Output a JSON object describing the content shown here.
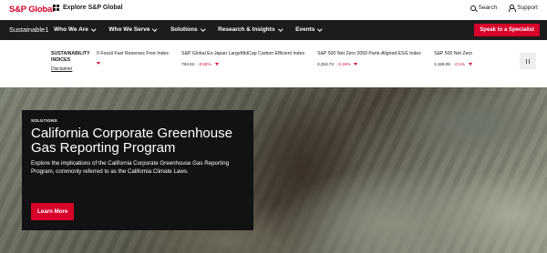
{
  "topbar": {
    "logo": "S&P Global",
    "explore_label": "Explore S&P Global",
    "search_label": "Search",
    "support_label": "Support"
  },
  "nav": {
    "brand": "Sustainable1",
    "items": [
      {
        "label": "Who We Are"
      },
      {
        "label": "Who We Serve"
      },
      {
        "label": "Solutions"
      },
      {
        "label": "Research & Insights"
      },
      {
        "label": "Events"
      }
    ],
    "cta_label": "Speak to a Specialist"
  },
  "indices": {
    "title_line1": "SUSTAINABILITY",
    "title_line2": "INDICES",
    "disclaimer": "Disclaimer",
    "cards": [
      {
        "name": "0 Fossil Fuel Reserves Free Index",
        "value": "",
        "change": ""
      },
      {
        "name": "S&P Global Ex-Japan LargeMidCap Carbon Efficient Index",
        "value": "793.04",
        "change": "-0.84%"
      },
      {
        "name": "S&P 500 Net Zero 2050 Paris-Aligned ESG Index",
        "value": "3,253.73",
        "change": "-0.15%"
      },
      {
        "name": "S&P 500 Net Zero",
        "value": "3,188.05",
        "change": "-0.1%"
      }
    ]
  },
  "hero": {
    "eyebrow": "SOLUTIONS",
    "title": "California Corporate Greenhouse Gas Reporting Program",
    "description": "Explore the implications of the California Corporate Greenhouse Gas Reporting Program, commonly referred to as the California Climate Laws.",
    "button_label": "Learn More"
  },
  "colors": {
    "brand_red": "#d6002a",
    "nav_bg": "#1c1c1c",
    "hero_card_bg": "#121212"
  }
}
